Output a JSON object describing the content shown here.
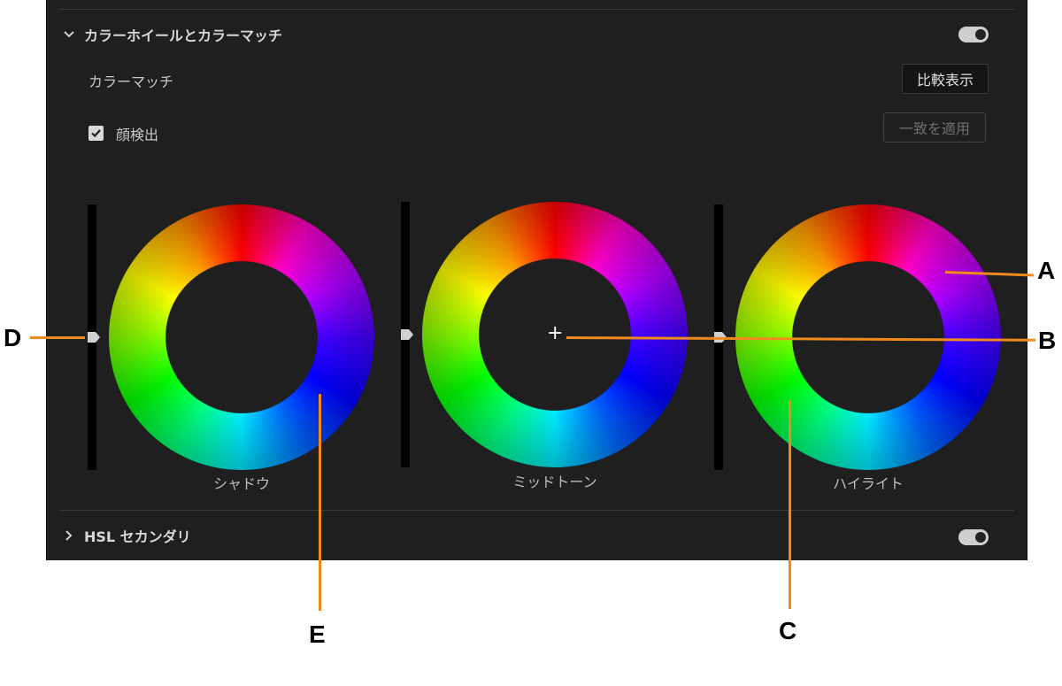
{
  "section_color": {
    "title": "カラーホイールとカラーマッチ",
    "expanded": true,
    "enabled": true
  },
  "color_match": {
    "label": "カラーマッチ",
    "compare_button": "比較表示",
    "face_detect_label": "顔検出",
    "face_detect_checked": true,
    "apply_button": "一致を適用"
  },
  "wheels": [
    {
      "label": "シャドウ"
    },
    {
      "label": "ミッドトーン"
    },
    {
      "label": "ハイライト"
    }
  ],
  "section_hsl": {
    "title": "HSL セカンダリ",
    "expanded": false,
    "enabled": true
  },
  "callouts": {
    "A": "A",
    "B": "B",
    "C": "C",
    "D": "D",
    "E": "E"
  },
  "colors": {
    "panel_bg": "#1f1f1f",
    "callout": "#f08a1c"
  }
}
